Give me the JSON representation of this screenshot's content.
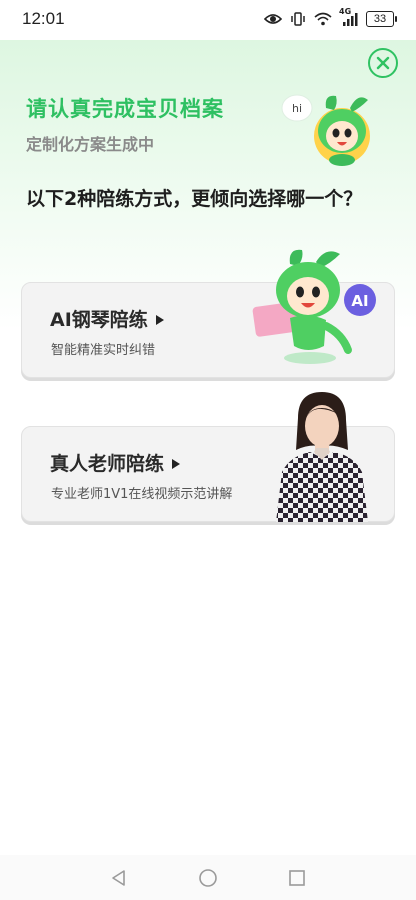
{
  "status": {
    "time": "12:01",
    "battery": "33",
    "net": "4G"
  },
  "header": {
    "title": "请认真完成宝贝档案",
    "subtitle": "定制化方案生成中",
    "bubble": "hi",
    "question": "以下2种陪练方式，更倾向选择哪一个？"
  },
  "options": [
    {
      "title": "AI钢琴陪练",
      "desc": "智能精准实时纠错",
      "badge": "AI"
    },
    {
      "title": "真人老师陪练",
      "desc": "专业老师1V1在线视频示范讲解"
    }
  ],
  "colors": {
    "accent": "#2ec062",
    "card": "#f3f3f3",
    "purple": "#6b5fe0"
  },
  "icons": [
    "eye-icon",
    "vibrate-icon",
    "wifi-icon",
    "signal-icon",
    "battery-icon",
    "close-icon",
    "play-icon",
    "back-icon",
    "home-icon",
    "recents-icon"
  ]
}
